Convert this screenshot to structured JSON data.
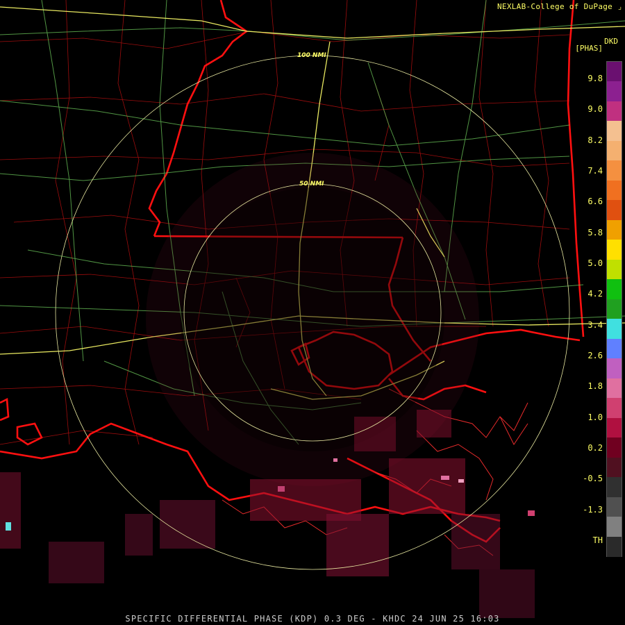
{
  "credit": "NEXLAB-College of DuPage",
  "footer": "SPECIFIC DIFFERENTIAL PHASE (KDP) 0.3 DEG - KHDC 24 JUN 25 16:03",
  "product": {
    "code": "DKD",
    "unit": "[PHAS]"
  },
  "range_rings": {
    "outer_label": "100 NMI",
    "inner_label": "50 NMI"
  },
  "legend": {
    "ticks": [
      "9.8",
      "9.0",
      "8.2",
      "7.4",
      "6.6",
      "5.8",
      "5.0",
      "4.2",
      "3.4",
      "2.6",
      "1.8",
      "1.0",
      "0.2",
      "-0.5",
      "-1.3",
      "TH"
    ],
    "colors": [
      "#6a1070",
      "#8c2090",
      "#c03080",
      "#f4c090",
      "#f4b070",
      "#f49040",
      "#f07020",
      "#e05010",
      "#f0a000",
      "#ffe000",
      "#c0e000",
      "#10c010",
      "#20a020",
      "#40e0e0",
      "#6080ff",
      "#c060c0",
      "#e070a0",
      "#d04070",
      "#b01040",
      "#700020",
      "#501020",
      "#303030",
      "#505050",
      "#808080",
      "#2a2a2a"
    ]
  },
  "colors": {
    "state_border": "#ff1010",
    "county_border": "#cc1010",
    "interstate": "#e8e860",
    "highway": "#70c060",
    "range_ring": "#e8e8a0",
    "echo": "#8a1030"
  },
  "icons": {
    "credit_marker": "bracket-icon"
  }
}
